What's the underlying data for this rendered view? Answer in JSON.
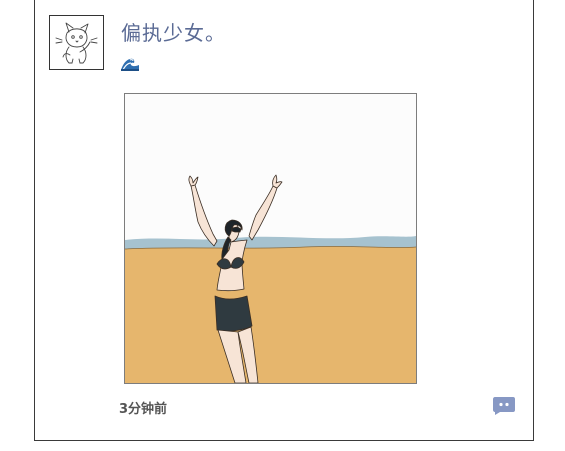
{
  "post": {
    "username": "偏执少女。",
    "timestamp": "3分钟前"
  },
  "icons": {
    "avatar": "cat-avatar",
    "status_emoji": "water-wave-icon",
    "comment": "comment-icon"
  },
  "colors": {
    "username": "#5b6b95",
    "comment_icon": "#8798c4",
    "sand": "#e6b66d",
    "sea": "#a6c2cf"
  }
}
